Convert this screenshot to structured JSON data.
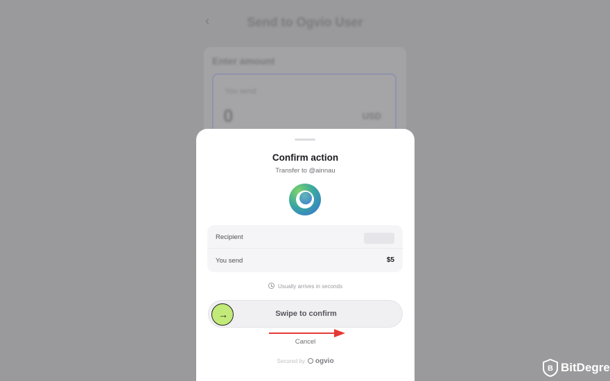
{
  "background": {
    "title": "Send to Ogvio User",
    "section_label": "Enter amount",
    "input_label": "You send",
    "input_value": "0",
    "input_unit": "USD"
  },
  "modal": {
    "title": "Confirm action",
    "subtitle": "Transfer to @ainnau",
    "details": {
      "recipient_label": "Recipient",
      "recipient_value": "",
      "send_label": "You send",
      "send_value": "$5"
    },
    "arrival_text": "Usually arrives in seconds",
    "swipe_label": "Swipe to confirm",
    "cancel_label": "Cancel",
    "secured_prefix": "Secured by",
    "secured_brand": "ogvio"
  },
  "watermark": {
    "text": "BitDegree"
  },
  "colors": {
    "swipe_handle": "#c2ea78",
    "annotation_arrow": "#e53935",
    "overlay": "#9a9a9c"
  }
}
